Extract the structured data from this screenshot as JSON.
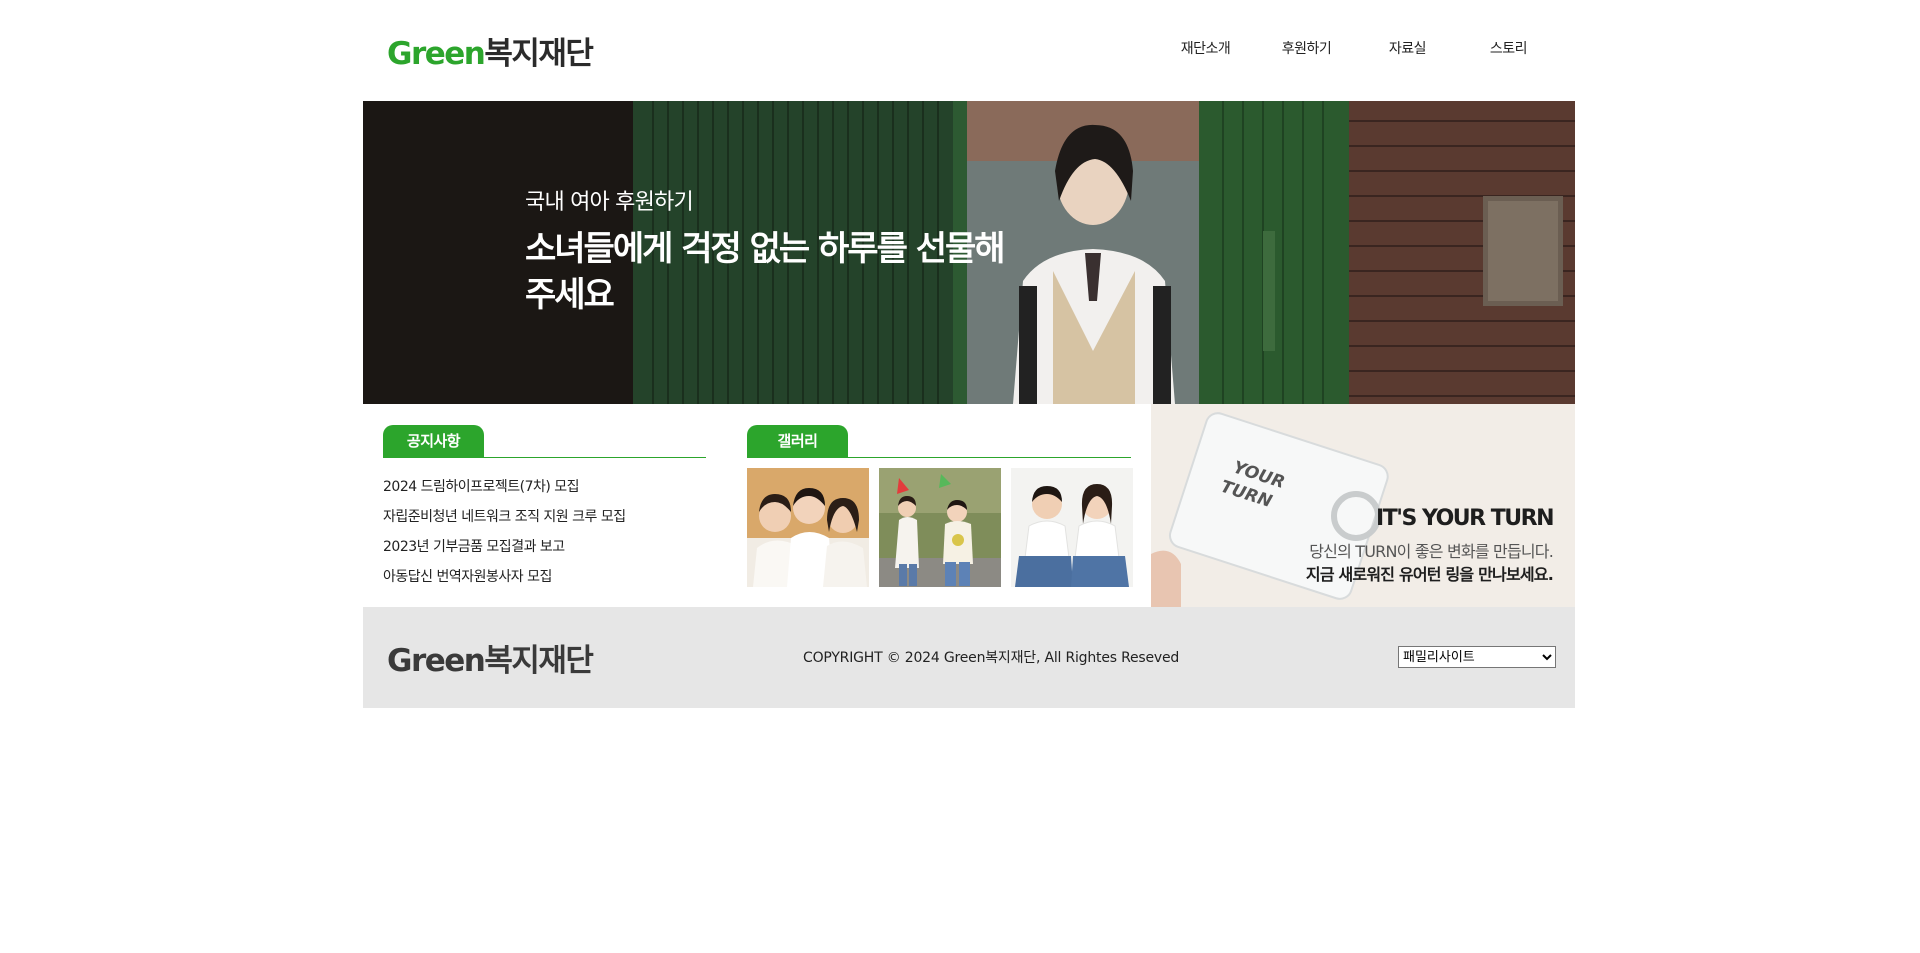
{
  "header": {
    "logo_green": "Green",
    "logo_text": "복지재단",
    "nav": [
      "재단소개",
      "후원하기",
      "자료실",
      "스토리"
    ]
  },
  "hero": {
    "subtitle": "국내 여아 후원하기",
    "title": "소녀들에게 걱정 없는 하루를 선물해 주세요"
  },
  "notice": {
    "tab_label": "공지사항",
    "items": [
      "2024 드림하이프로젝트(7차) 모집",
      "자립준비청년 네트워크 조직 지원 크루 모집",
      "2023년 기부금품 모집결과 보고",
      "아동답신 번역자원봉사자 모집"
    ]
  },
  "gallery": {
    "tab_label": "갤러리"
  },
  "banner": {
    "card_text_1": "YOUR",
    "card_text_2": "TURN",
    "heading": "IT'S YOUR TURN",
    "line1": "당신의 TURN이 좋은 변화를 만듭니다.",
    "line2": "지금 새로워진 유어턴 링을 만나보세요."
  },
  "footer": {
    "logo": "Green복지재단",
    "copyright": "COPYRIGHT © 2024 Green복지재단, All Rightes Reseved",
    "family_site": "패밀리사이트"
  },
  "colors": {
    "brand_green": "#2ca52c",
    "footer_bg": "#e6e6e6"
  }
}
